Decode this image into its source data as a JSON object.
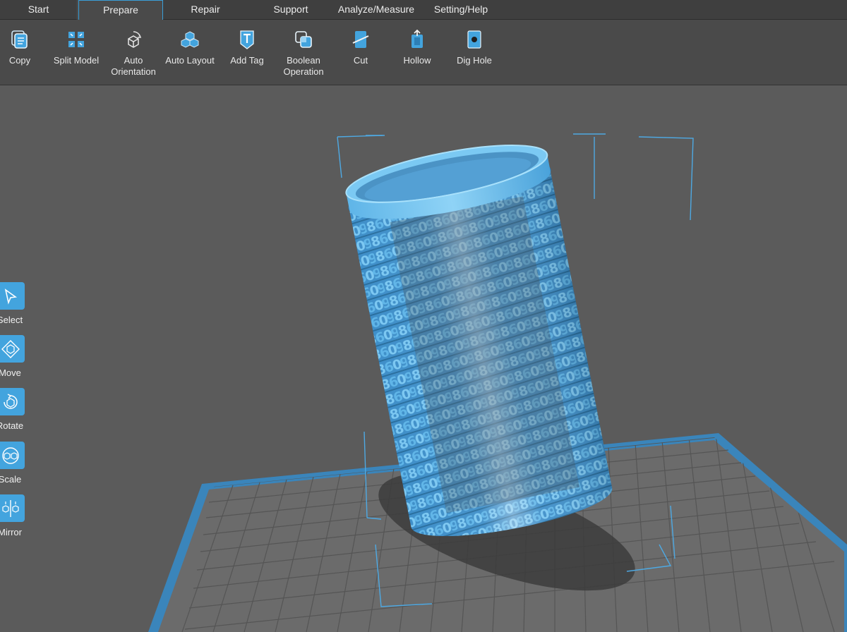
{
  "tabs": [
    {
      "label": "Start"
    },
    {
      "label": "Prepare",
      "active": true
    },
    {
      "label": "Repair"
    },
    {
      "label": "Support"
    },
    {
      "label": "Analyze/Measure"
    },
    {
      "label": "Setting/Help"
    }
  ],
  "toolbar": [
    {
      "label": "Copy",
      "icon": "copy-icon"
    },
    {
      "label": "Split Model",
      "icon": "split-model-icon"
    },
    {
      "label": "Auto\nOrientation",
      "icon": "auto-orientation-icon"
    },
    {
      "label": "Auto Layout",
      "icon": "auto-layout-icon"
    },
    {
      "label": "Add Tag",
      "icon": "add-tag-icon"
    },
    {
      "label": "Boolean\nOperation",
      "icon": "boolean-operation-icon"
    },
    {
      "label": "Cut",
      "icon": "cut-icon"
    },
    {
      "label": "Hollow",
      "icon": "hollow-icon"
    },
    {
      "label": "Dig Hole",
      "icon": "dig-hole-icon"
    }
  ],
  "side_tools": [
    {
      "label": "Select",
      "icon": "select-icon"
    },
    {
      "label": "Move",
      "icon": "move-icon"
    },
    {
      "label": "Rotate",
      "icon": "rotate-icon"
    },
    {
      "label": "Scale",
      "icon": "scale-icon"
    },
    {
      "label": "Mirror",
      "icon": "mirror-icon"
    }
  ],
  "colors": {
    "accent": "#43a4de",
    "model": "#4aa8e0",
    "background": "#5b5b5b",
    "toolbar": "#4a4a4a",
    "grid_plate": "#6b6b6b",
    "plate_border": "#4c95c9"
  }
}
